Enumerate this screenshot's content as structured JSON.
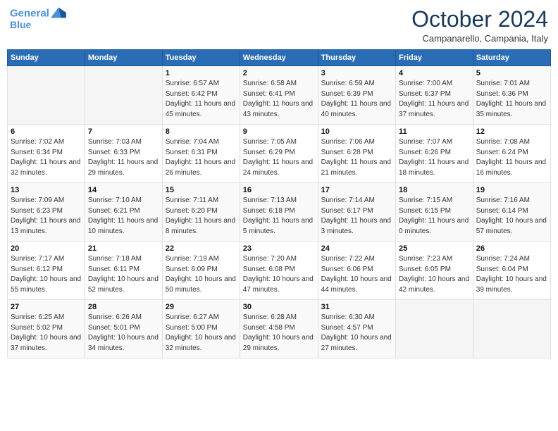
{
  "header": {
    "logo_line1": "General",
    "logo_line2": "Blue",
    "month": "October 2024",
    "location": "Campanarello, Campania, Italy"
  },
  "weekdays": [
    "Sunday",
    "Monday",
    "Tuesday",
    "Wednesday",
    "Thursday",
    "Friday",
    "Saturday"
  ],
  "weeks": [
    [
      {
        "day": "",
        "info": ""
      },
      {
        "day": "",
        "info": ""
      },
      {
        "day": "1",
        "info": "Sunrise: 6:57 AM\nSunset: 6:42 PM\nDaylight: 11 hours and 45 minutes."
      },
      {
        "day": "2",
        "info": "Sunrise: 6:58 AM\nSunset: 6:41 PM\nDaylight: 11 hours and 43 minutes."
      },
      {
        "day": "3",
        "info": "Sunrise: 6:59 AM\nSunset: 6:39 PM\nDaylight: 11 hours and 40 minutes."
      },
      {
        "day": "4",
        "info": "Sunrise: 7:00 AM\nSunset: 6:37 PM\nDaylight: 11 hours and 37 minutes."
      },
      {
        "day": "5",
        "info": "Sunrise: 7:01 AM\nSunset: 6:36 PM\nDaylight: 11 hours and 35 minutes."
      }
    ],
    [
      {
        "day": "6",
        "info": "Sunrise: 7:02 AM\nSunset: 6:34 PM\nDaylight: 11 hours and 32 minutes."
      },
      {
        "day": "7",
        "info": "Sunrise: 7:03 AM\nSunset: 6:33 PM\nDaylight: 11 hours and 29 minutes."
      },
      {
        "day": "8",
        "info": "Sunrise: 7:04 AM\nSunset: 6:31 PM\nDaylight: 11 hours and 26 minutes."
      },
      {
        "day": "9",
        "info": "Sunrise: 7:05 AM\nSunset: 6:29 PM\nDaylight: 11 hours and 24 minutes."
      },
      {
        "day": "10",
        "info": "Sunrise: 7:06 AM\nSunset: 6:28 PM\nDaylight: 11 hours and 21 minutes."
      },
      {
        "day": "11",
        "info": "Sunrise: 7:07 AM\nSunset: 6:26 PM\nDaylight: 11 hours and 18 minutes."
      },
      {
        "day": "12",
        "info": "Sunrise: 7:08 AM\nSunset: 6:24 PM\nDaylight: 11 hours and 16 minutes."
      }
    ],
    [
      {
        "day": "13",
        "info": "Sunrise: 7:09 AM\nSunset: 6:23 PM\nDaylight: 11 hours and 13 minutes."
      },
      {
        "day": "14",
        "info": "Sunrise: 7:10 AM\nSunset: 6:21 PM\nDaylight: 11 hours and 10 minutes."
      },
      {
        "day": "15",
        "info": "Sunrise: 7:11 AM\nSunset: 6:20 PM\nDaylight: 11 hours and 8 minutes."
      },
      {
        "day": "16",
        "info": "Sunrise: 7:13 AM\nSunset: 6:18 PM\nDaylight: 11 hours and 5 minutes."
      },
      {
        "day": "17",
        "info": "Sunrise: 7:14 AM\nSunset: 6:17 PM\nDaylight: 11 hours and 3 minutes."
      },
      {
        "day": "18",
        "info": "Sunrise: 7:15 AM\nSunset: 6:15 PM\nDaylight: 11 hours and 0 minutes."
      },
      {
        "day": "19",
        "info": "Sunrise: 7:16 AM\nSunset: 6:14 PM\nDaylight: 10 hours and 57 minutes."
      }
    ],
    [
      {
        "day": "20",
        "info": "Sunrise: 7:17 AM\nSunset: 6:12 PM\nDaylight: 10 hours and 55 minutes."
      },
      {
        "day": "21",
        "info": "Sunrise: 7:18 AM\nSunset: 6:11 PM\nDaylight: 10 hours and 52 minutes."
      },
      {
        "day": "22",
        "info": "Sunrise: 7:19 AM\nSunset: 6:09 PM\nDaylight: 10 hours and 50 minutes."
      },
      {
        "day": "23",
        "info": "Sunrise: 7:20 AM\nSunset: 6:08 PM\nDaylight: 10 hours and 47 minutes."
      },
      {
        "day": "24",
        "info": "Sunrise: 7:22 AM\nSunset: 6:06 PM\nDaylight: 10 hours and 44 minutes."
      },
      {
        "day": "25",
        "info": "Sunrise: 7:23 AM\nSunset: 6:05 PM\nDaylight: 10 hours and 42 minutes."
      },
      {
        "day": "26",
        "info": "Sunrise: 7:24 AM\nSunset: 6:04 PM\nDaylight: 10 hours and 39 minutes."
      }
    ],
    [
      {
        "day": "27",
        "info": "Sunrise: 6:25 AM\nSunset: 5:02 PM\nDaylight: 10 hours and 37 minutes."
      },
      {
        "day": "28",
        "info": "Sunrise: 6:26 AM\nSunset: 5:01 PM\nDaylight: 10 hours and 34 minutes."
      },
      {
        "day": "29",
        "info": "Sunrise: 6:27 AM\nSunset: 5:00 PM\nDaylight: 10 hours and 32 minutes."
      },
      {
        "day": "30",
        "info": "Sunrise: 6:28 AM\nSunset: 4:58 PM\nDaylight: 10 hours and 29 minutes."
      },
      {
        "day": "31",
        "info": "Sunrise: 6:30 AM\nSunset: 4:57 PM\nDaylight: 10 hours and 27 minutes."
      },
      {
        "day": "",
        "info": ""
      },
      {
        "day": "",
        "info": ""
      }
    ]
  ]
}
